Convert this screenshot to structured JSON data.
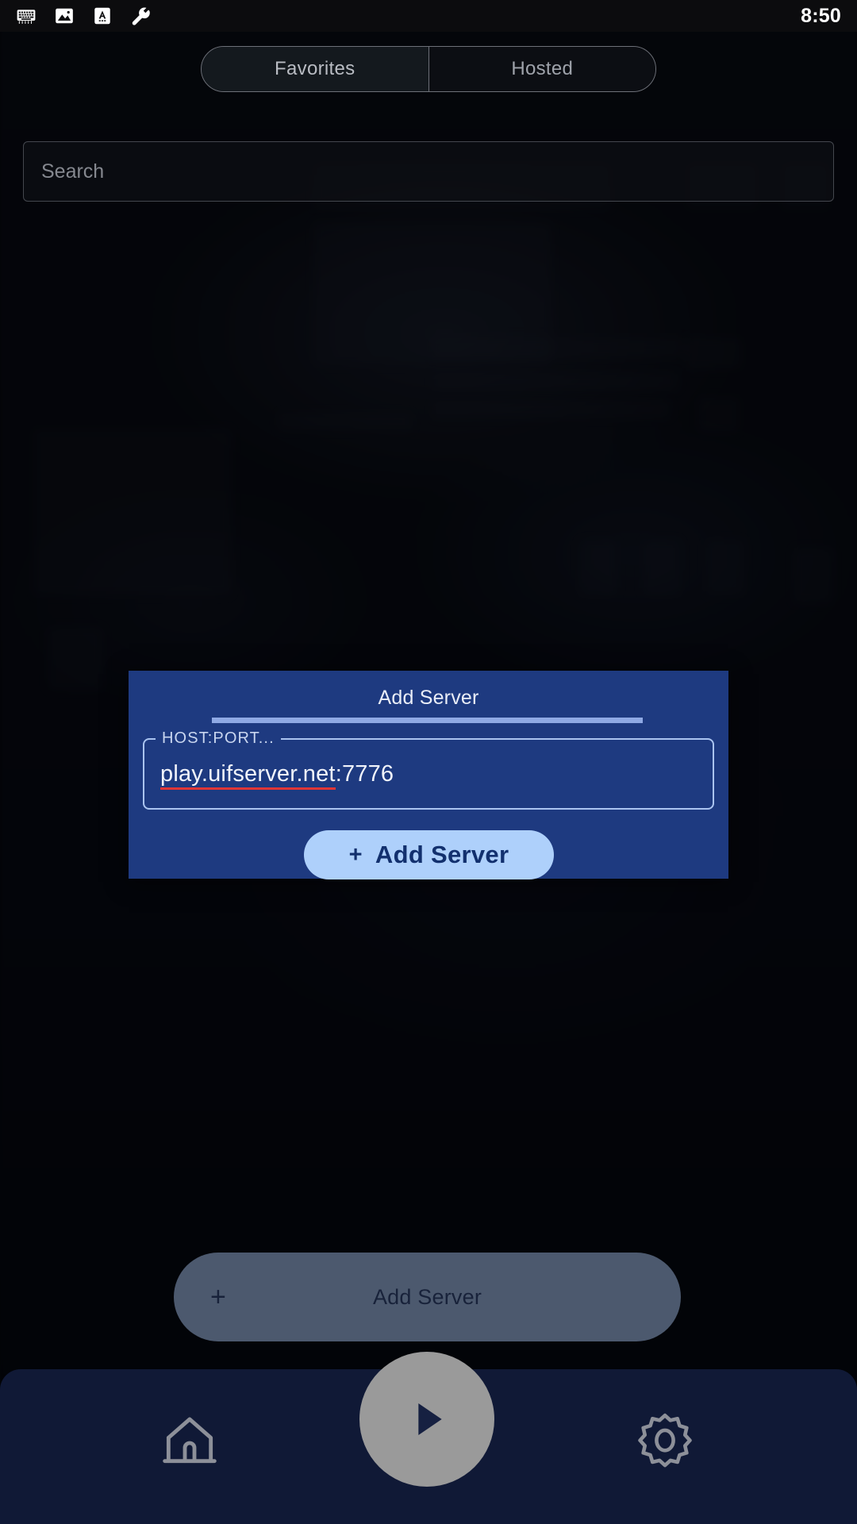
{
  "status_bar": {
    "time": "8:50",
    "icons": [
      "keyboard-icon",
      "image-icon",
      "text-format-icon",
      "wrench-icon"
    ]
  },
  "tabs": [
    {
      "label": "Favorites",
      "selected": true
    },
    {
      "label": "Hosted",
      "selected": false
    }
  ],
  "search": {
    "value": "",
    "placeholder": "Search"
  },
  "dialog": {
    "title": "Add Server",
    "field": {
      "label": "HOST:PORT...",
      "host": "play.uifserver.net",
      "port": ":7776",
      "spellcheck_underline": true
    },
    "submit": {
      "plus": "+",
      "label": "Add Server"
    }
  },
  "add_server_button": {
    "plus": "+",
    "label": "Add Server"
  },
  "bottom_nav": {
    "items": [
      {
        "name": "home-icon"
      },
      {
        "name": "play-icon"
      },
      {
        "name": "settings-gear-icon"
      }
    ]
  },
  "colors": {
    "dialog_bg": "#1e3a80",
    "dialog_accent": "#8fa9e4",
    "dialog_button_bg": "#aed0fb",
    "dialog_button_text": "#12306e",
    "add_button_bg": "#4c596e",
    "nav_bg": "#101936",
    "play_fab": "#9a9a9a",
    "spellcheck_red": "#e03636",
    "page_bg": "#05060a"
  }
}
